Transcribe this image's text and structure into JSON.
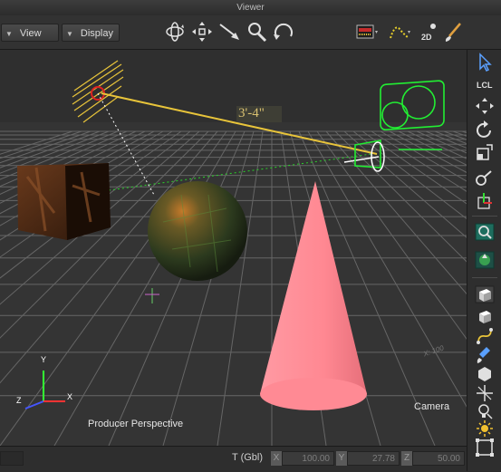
{
  "window": {
    "title": "Viewer"
  },
  "toolbar": {
    "view_label": "View",
    "display_label": "Display",
    "mode_2d_label": "2D",
    "tools": [
      "orbit-icon",
      "pan-icon",
      "dolly-icon",
      "zoom-icon",
      "undo-view-icon",
      "ruler-icon",
      "path-icon",
      "2d-mode-icon",
      "paint-brush-icon"
    ]
  },
  "viewport": {
    "camera_name": "Producer Perspective",
    "camera_object_label": "Camera",
    "measurement_label": "3'-4\"",
    "grid_label": "X: 100",
    "gizmo": {
      "x": "X",
      "y": "Y",
      "z": "Z"
    },
    "colors": {
      "background": "#343434",
      "grid": "#666666",
      "cone": "#ff8a94",
      "camera_wire": "#22ee33",
      "light_wire": "#e8c43a",
      "measure_line": "#e8c43a"
    }
  },
  "right_toolbar": {
    "local_label": "LCL",
    "tools": [
      "select-arrow-icon",
      "local-space-icon",
      "move-icon",
      "rotate-icon",
      "scale-icon",
      "link-icon",
      "pivot-icon",
      "camera-search-icon",
      "texture-icon",
      "box-icon",
      "cube-icon",
      "spline-icon",
      "brush-icon",
      "polygon-icon",
      "null-icon",
      "light-bulb-icon",
      "sun-icon",
      "frame-icon"
    ]
  },
  "status": {
    "transform_label": "T (Gbl)",
    "x_tag": "X",
    "x_value": "100.00",
    "y_tag": "Y",
    "y_value": "27.78",
    "z_tag": "Z",
    "z_value": "50.00"
  }
}
